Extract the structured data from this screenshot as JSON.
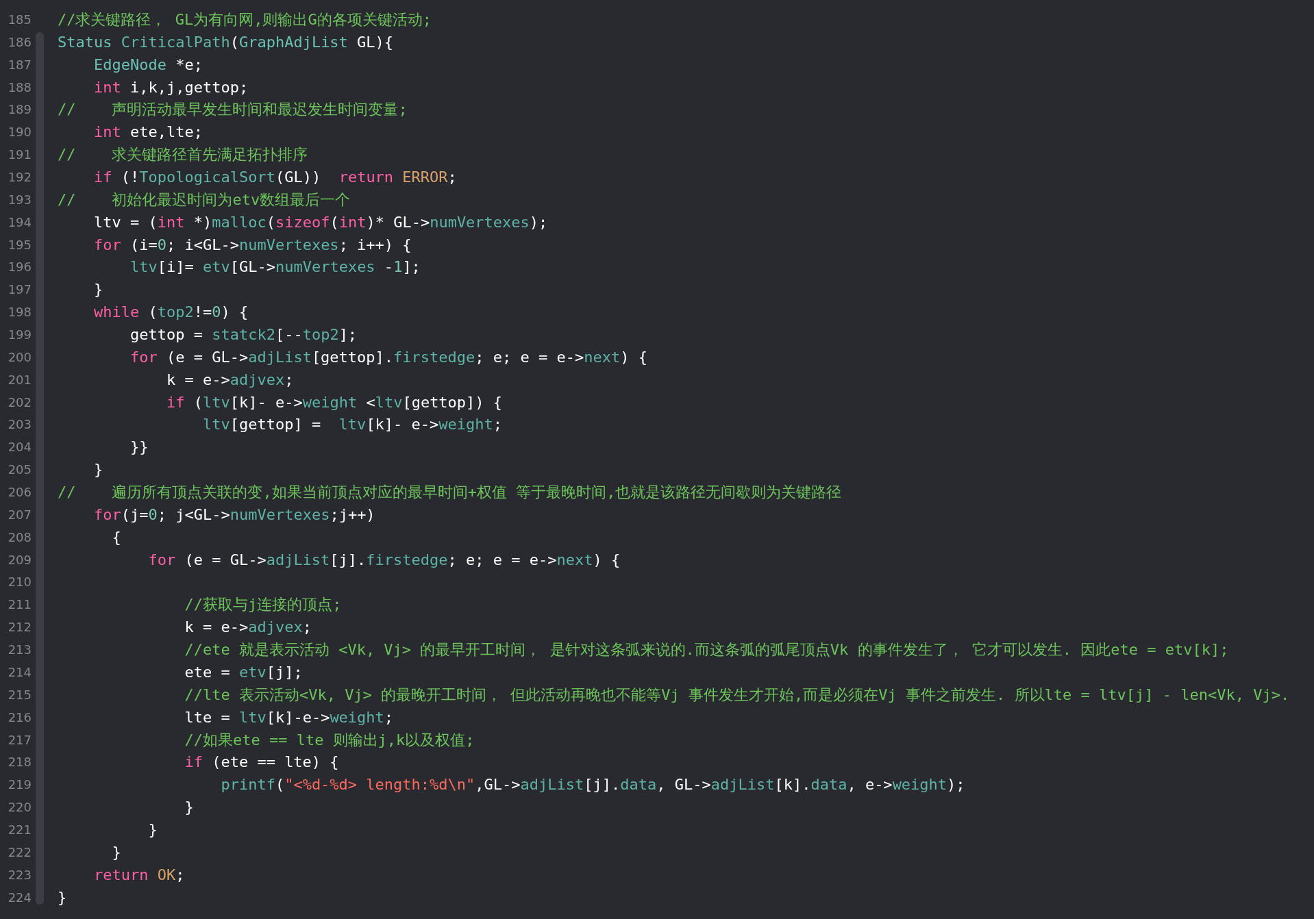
{
  "editor": {
    "lines": [
      {
        "number": "185",
        "tokens": [
          {
            "kind": "comment",
            "text": "//求关键路径， GL为有向网,则输出G的各项关键活动;"
          }
        ]
      },
      {
        "number": "186",
        "tokens": [
          {
            "kind": "type",
            "text": "Status "
          },
          {
            "kind": "function",
            "text": "CriticalPath"
          },
          {
            "kind": "plain",
            "text": "("
          },
          {
            "kind": "type",
            "text": "GraphAdjList"
          },
          {
            "kind": "plain",
            "text": " GL){"
          }
        ]
      },
      {
        "number": "187",
        "tokens": [
          {
            "kind": "type",
            "text": "    EdgeNode"
          },
          {
            "kind": "plain",
            "text": " *e;"
          }
        ]
      },
      {
        "number": "188",
        "tokens": [
          {
            "kind": "keyword",
            "text": "    int"
          },
          {
            "kind": "plain",
            "text": " i,k,j,gettop;"
          }
        ]
      },
      {
        "number": "189",
        "tokens": [
          {
            "kind": "comment",
            "text": "//    声明活动最早发生时间和最迟发生时间变量;"
          }
        ]
      },
      {
        "number": "190",
        "tokens": [
          {
            "kind": "keyword",
            "text": "    int"
          },
          {
            "kind": "plain",
            "text": " ete,lte;"
          }
        ]
      },
      {
        "number": "191",
        "tokens": [
          {
            "kind": "comment",
            "text": "//    求关键路径首先满足拓扑排序"
          }
        ]
      },
      {
        "number": "192",
        "tokens": [
          {
            "kind": "keyword",
            "text": "    if"
          },
          {
            "kind": "plain",
            "text": " (!"
          },
          {
            "kind": "function",
            "text": "TopologicalSort"
          },
          {
            "kind": "plain",
            "text": "(GL))  "
          },
          {
            "kind": "keyword",
            "text": "return "
          },
          {
            "kind": "constant",
            "text": "ERROR"
          },
          {
            "kind": "plain",
            "text": ";"
          }
        ]
      },
      {
        "number": "193",
        "tokens": [
          {
            "kind": "comment",
            "text": "//    初始化最迟时间为etv数组最后一个"
          }
        ]
      },
      {
        "number": "194",
        "tokens": [
          {
            "kind": "plain",
            "text": "    ltv = ("
          },
          {
            "kind": "keyword",
            "text": "int"
          },
          {
            "kind": "plain",
            "text": " *)"
          },
          {
            "kind": "function",
            "text": "malloc"
          },
          {
            "kind": "plain",
            "text": "("
          },
          {
            "kind": "keyword",
            "text": "sizeof"
          },
          {
            "kind": "plain",
            "text": "("
          },
          {
            "kind": "keyword",
            "text": "int"
          },
          {
            "kind": "plain",
            "text": ")* GL->"
          },
          {
            "kind": "identifier",
            "text": "numVertexes"
          },
          {
            "kind": "plain",
            "text": ");"
          }
        ]
      },
      {
        "number": "195",
        "tokens": [
          {
            "kind": "keyword",
            "text": "    for"
          },
          {
            "kind": "plain",
            "text": " (i="
          },
          {
            "kind": "number",
            "text": "0"
          },
          {
            "kind": "plain",
            "text": "; i<GL->"
          },
          {
            "kind": "identifier",
            "text": "numVertexes"
          },
          {
            "kind": "plain",
            "text": "; i++) {"
          }
        ]
      },
      {
        "number": "196",
        "tokens": [
          {
            "kind": "identifier",
            "text": "        ltv"
          },
          {
            "kind": "plain",
            "text": "[i]= "
          },
          {
            "kind": "identifier",
            "text": "etv"
          },
          {
            "kind": "plain",
            "text": "[GL->"
          },
          {
            "kind": "identifier",
            "text": "numVertexes"
          },
          {
            "kind": "plain",
            "text": " -"
          },
          {
            "kind": "number",
            "text": "1"
          },
          {
            "kind": "plain",
            "text": "];"
          }
        ]
      },
      {
        "number": "197",
        "tokens": [
          {
            "kind": "plain",
            "text": "    }"
          }
        ]
      },
      {
        "number": "198",
        "tokens": [
          {
            "kind": "keyword",
            "text": "    while"
          },
          {
            "kind": "plain",
            "text": " ("
          },
          {
            "kind": "identifier",
            "text": "top2"
          },
          {
            "kind": "plain",
            "text": "!="
          },
          {
            "kind": "number",
            "text": "0"
          },
          {
            "kind": "plain",
            "text": ") {"
          }
        ]
      },
      {
        "number": "199",
        "tokens": [
          {
            "kind": "plain",
            "text": "        gettop = "
          },
          {
            "kind": "identifier",
            "text": "statck2"
          },
          {
            "kind": "plain",
            "text": "[--"
          },
          {
            "kind": "identifier",
            "text": "top2"
          },
          {
            "kind": "plain",
            "text": "];"
          }
        ]
      },
      {
        "number": "200",
        "tokens": [
          {
            "kind": "keyword",
            "text": "        for"
          },
          {
            "kind": "plain",
            "text": " (e = GL->"
          },
          {
            "kind": "identifier",
            "text": "adjList"
          },
          {
            "kind": "plain",
            "text": "[gettop]."
          },
          {
            "kind": "identifier",
            "text": "firstedge"
          },
          {
            "kind": "plain",
            "text": "; e; e = e->"
          },
          {
            "kind": "identifier",
            "text": "next"
          },
          {
            "kind": "plain",
            "text": ") {"
          }
        ]
      },
      {
        "number": "201",
        "tokens": [
          {
            "kind": "plain",
            "text": "            k = e->"
          },
          {
            "kind": "identifier",
            "text": "adjvex"
          },
          {
            "kind": "plain",
            "text": ";"
          }
        ]
      },
      {
        "number": "202",
        "tokens": [
          {
            "kind": "keyword",
            "text": "            if"
          },
          {
            "kind": "plain",
            "text": " ("
          },
          {
            "kind": "identifier",
            "text": "ltv"
          },
          {
            "kind": "plain",
            "text": "[k]- e->"
          },
          {
            "kind": "identifier",
            "text": "weight"
          },
          {
            "kind": "plain",
            "text": " <"
          },
          {
            "kind": "identifier",
            "text": "ltv"
          },
          {
            "kind": "plain",
            "text": "[gettop]) {"
          }
        ]
      },
      {
        "number": "203",
        "tokens": [
          {
            "kind": "identifier",
            "text": "                ltv"
          },
          {
            "kind": "plain",
            "text": "[gettop] =  "
          },
          {
            "kind": "identifier",
            "text": "ltv"
          },
          {
            "kind": "plain",
            "text": "[k]- e->"
          },
          {
            "kind": "identifier",
            "text": "weight"
          },
          {
            "kind": "plain",
            "text": ";"
          }
        ]
      },
      {
        "number": "204",
        "tokens": [
          {
            "kind": "plain",
            "text": "        }}"
          }
        ]
      },
      {
        "number": "205",
        "tokens": [
          {
            "kind": "plain",
            "text": "    }"
          }
        ]
      },
      {
        "number": "206",
        "tokens": [
          {
            "kind": "comment",
            "text": "//    遍历所有顶点关联的变,如果当前顶点对应的最早时间+权值 等于最晚时间,也就是该路径无间歇则为关键路径"
          }
        ]
      },
      {
        "number": "207",
        "tokens": [
          {
            "kind": "keyword",
            "text": "    for"
          },
          {
            "kind": "plain",
            "text": "(j="
          },
          {
            "kind": "number",
            "text": "0"
          },
          {
            "kind": "plain",
            "text": "; j<GL->"
          },
          {
            "kind": "identifier",
            "text": "numVertexes"
          },
          {
            "kind": "plain",
            "text": ";j++)"
          }
        ]
      },
      {
        "number": "208",
        "tokens": [
          {
            "kind": "plain",
            "text": "      {"
          }
        ]
      },
      {
        "number": "209",
        "tokens": [
          {
            "kind": "keyword",
            "text": "          for"
          },
          {
            "kind": "plain",
            "text": " (e = GL->"
          },
          {
            "kind": "identifier",
            "text": "adjList"
          },
          {
            "kind": "plain",
            "text": "[j]."
          },
          {
            "kind": "identifier",
            "text": "firstedge"
          },
          {
            "kind": "plain",
            "text": "; e; e = e->"
          },
          {
            "kind": "identifier",
            "text": "next"
          },
          {
            "kind": "plain",
            "text": ") {"
          }
        ]
      },
      {
        "number": "210"
      },
      {
        "number": "211",
        "tokens": [
          {
            "kind": "comment",
            "text": "              //获取与j连接的顶点;"
          }
        ]
      },
      {
        "number": "212",
        "tokens": [
          {
            "kind": "plain",
            "text": "              k = e->"
          },
          {
            "kind": "identifier",
            "text": "adjvex"
          },
          {
            "kind": "plain",
            "text": ";"
          }
        ]
      },
      {
        "number": "213",
        "tokens": [
          {
            "kind": "comment",
            "text": "              //ete 就是表示活动 <Vk, Vj> 的最早开工时间， 是针对这条弧来说的.而这条弧的弧尾顶点Vk 的事件发生了， 它才可以发生. 因此ete = etv[k];"
          }
        ]
      },
      {
        "number": "214",
        "tokens": [
          {
            "kind": "plain",
            "text": "              ete = "
          },
          {
            "kind": "identifier",
            "text": "etv"
          },
          {
            "kind": "plain",
            "text": "[j];"
          }
        ]
      },
      {
        "number": "215",
        "tokens": [
          {
            "kind": "comment",
            "text": "              //lte 表示活动<Vk, Vj> 的最晚开工时间， 但此活动再晚也不能等Vj 事件发生才开始,而是必须在Vj 事件之前发生. 所以lte = ltv[j] - len<Vk, Vj>."
          }
        ]
      },
      {
        "number": "216",
        "tokens": [
          {
            "kind": "plain",
            "text": "              lte = "
          },
          {
            "kind": "identifier",
            "text": "ltv"
          },
          {
            "kind": "plain",
            "text": "[k]-e->"
          },
          {
            "kind": "identifier",
            "text": "weight"
          },
          {
            "kind": "plain",
            "text": ";"
          }
        ]
      },
      {
        "number": "217",
        "tokens": [
          {
            "kind": "comment",
            "text": "              //如果ete == lte 则输出j,k以及权值;"
          }
        ]
      },
      {
        "number": "218",
        "tokens": [
          {
            "kind": "keyword",
            "text": "              if"
          },
          {
            "kind": "plain",
            "text": " (ete == lte) {"
          }
        ]
      },
      {
        "number": "219",
        "tokens": [
          {
            "kind": "function",
            "text": "                  printf"
          },
          {
            "kind": "plain",
            "text": "("
          },
          {
            "kind": "string",
            "text": "\"<%d-%d> length:%d\\n\""
          },
          {
            "kind": "plain",
            "text": ",GL->"
          },
          {
            "kind": "identifier",
            "text": "adjList"
          },
          {
            "kind": "plain",
            "text": "[j]."
          },
          {
            "kind": "identifier",
            "text": "data"
          },
          {
            "kind": "plain",
            "text": ", GL->"
          },
          {
            "kind": "identifier",
            "text": "adjList"
          },
          {
            "kind": "plain",
            "text": "[k]."
          },
          {
            "kind": "identifier",
            "text": "data"
          },
          {
            "kind": "plain",
            "text": ", e->"
          },
          {
            "kind": "identifier",
            "text": "weight"
          },
          {
            "kind": "plain",
            "text": ");"
          }
        ]
      },
      {
        "number": "220",
        "tokens": [
          {
            "kind": "plain",
            "text": "              }"
          }
        ]
      },
      {
        "number": "221",
        "tokens": [
          {
            "kind": "plain",
            "text": "          }"
          }
        ]
      },
      {
        "number": "222",
        "tokens": [
          {
            "kind": "plain",
            "text": "      }"
          }
        ]
      },
      {
        "number": "223",
        "tokens": [
          {
            "kind": "keyword",
            "text": "    return "
          },
          {
            "kind": "constant",
            "text": "OK"
          },
          {
            "kind": "plain",
            "text": ";"
          }
        ]
      },
      {
        "number": "224",
        "tokens": [
          {
            "kind": "plain",
            "text": "}"
          }
        ]
      }
    ]
  }
}
